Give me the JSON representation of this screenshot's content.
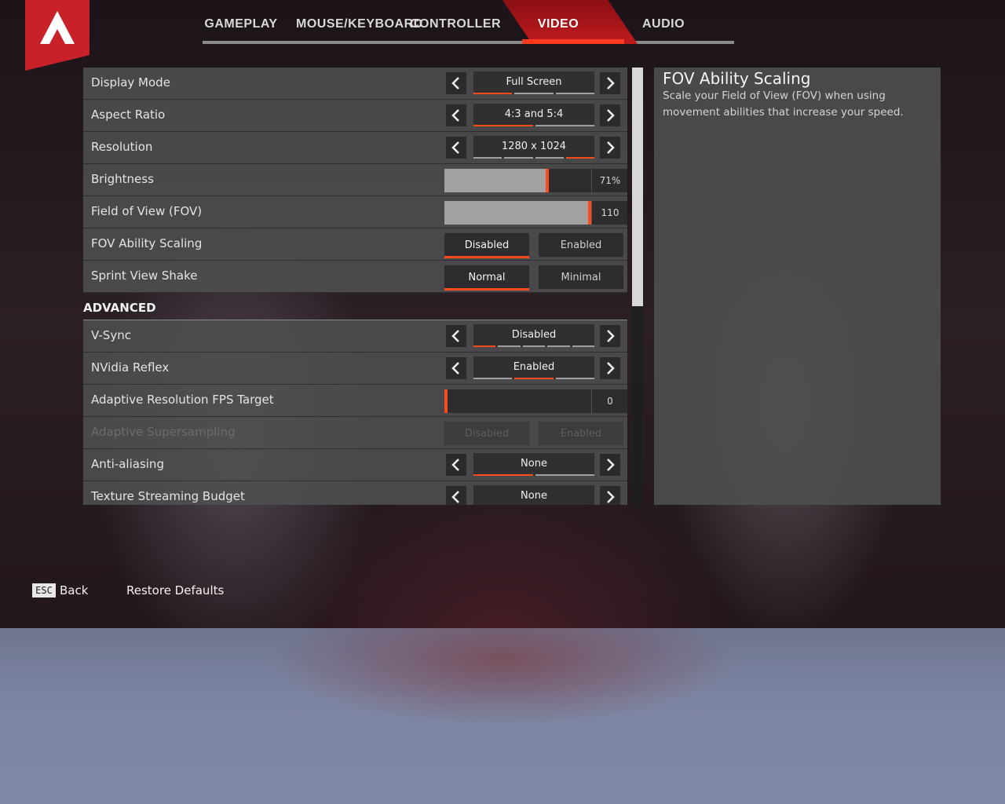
{
  "tabs": [
    "GAMEPLAY",
    "MOUSE/KEYBOARD",
    "CONTROLLER",
    "VIDEO",
    "AUDIO"
  ],
  "active_tab": "VIDEO",
  "settings": {
    "display_mode": {
      "label": "Display Mode",
      "value": "Full Screen"
    },
    "aspect_ratio": {
      "label": "Aspect Ratio",
      "value": "4:3 and 5:4"
    },
    "resolution": {
      "label": "Resolution",
      "value": "1280 x 1024"
    },
    "brightness": {
      "label": "Brightness",
      "value": "71%",
      "level": 0.71
    },
    "fov": {
      "label": "Field of View (FOV)",
      "value": "110",
      "level": 1.0
    },
    "fov_scaling": {
      "label": "FOV Ability Scaling",
      "option_a": "Disabled",
      "option_b": "Enabled",
      "selected": "Disabled"
    },
    "sprint_shake": {
      "label": "Sprint View Shake",
      "option_a": "Normal",
      "option_b": "Minimal",
      "selected": "Normal"
    },
    "advanced_header": "ADVANCED",
    "vsync": {
      "label": "V-Sync",
      "value": "Disabled"
    },
    "reflex": {
      "label": "NVidia Reflex",
      "value": "Enabled"
    },
    "adaptive_res": {
      "label": "Adaptive Resolution FPS Target",
      "value": "0",
      "level": 0.0
    },
    "adaptive_ss": {
      "label": "Adaptive Supersampling",
      "option_a": "Disabled",
      "option_b": "Enabled"
    },
    "aa": {
      "label": "Anti-aliasing",
      "value": "None"
    },
    "texture_budget": {
      "label": "Texture Streaming Budget",
      "value": "None"
    }
  },
  "description": {
    "title": "FOV Ability Scaling",
    "body": "Scale your Field of View (FOV) when using movement abilities that increase your speed."
  },
  "footer": {
    "esc_key": "ESC",
    "back": "Back",
    "restore": "Restore Defaults"
  },
  "colors": {
    "accent": "#ff4a1c",
    "logo_red": "#c8212a",
    "panel": "#4e4e50"
  }
}
